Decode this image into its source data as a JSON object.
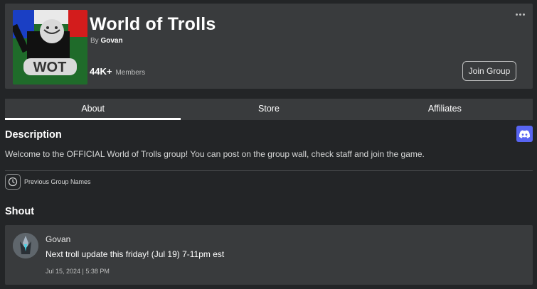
{
  "header": {
    "title": "World of Trolls",
    "owner_prefix": "By",
    "owner_name": "Govan",
    "member_count": "44K+",
    "member_label": "Members",
    "join_label": "Join Group",
    "emblem_text": "WOT",
    "more_icon": "more-dots-icon"
  },
  "tabs": [
    {
      "label": "About",
      "active": true
    },
    {
      "label": "Store",
      "active": false
    },
    {
      "label": "Affiliates",
      "active": false
    }
  ],
  "about": {
    "description_heading": "Description",
    "description_text": "Welcome to the OFFICIAL World of Trolls group! You can post on the group wall, check staff and join the game.",
    "previous_names_label": "Previous Group Names",
    "discord_icon": "discord-icon",
    "history_icon": "history-icon"
  },
  "shout": {
    "heading": "Shout",
    "poster": "Govan",
    "message": "Next troll update this friday! (Jul 19) 7-11pm est",
    "date": "Jul 15, 2024 | 5:38 PM"
  },
  "colors": {
    "background": "#232527",
    "card": "#393b3d",
    "discord": "#5865f2",
    "text": "#ffffff"
  }
}
